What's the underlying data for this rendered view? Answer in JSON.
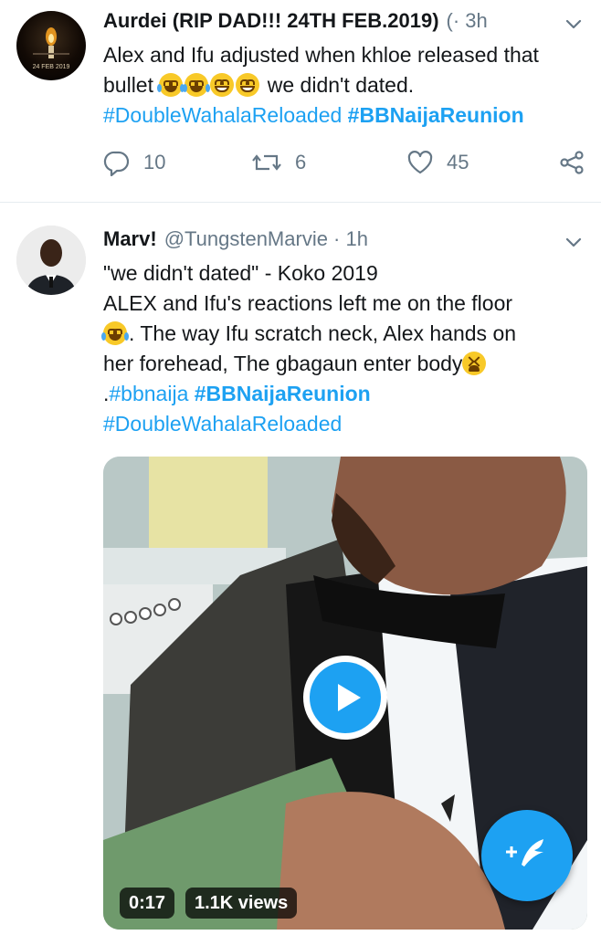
{
  "tweets": [
    {
      "name": "Aurdei (RIP DAD!!! 24TH FEB.2019)",
      "meta": "(· 3h",
      "avatar_text": "24 FEB 2019",
      "text_1": "Alex and Ifu adjusted when khloe released that bullet",
      "text_2": " we didn't dated.",
      "hashtag_1": "#DoubleWahalaReloaded",
      "hashtag_2": "#BBNaijaReunion",
      "emojis": [
        "joy",
        "joy",
        "grin",
        "grin"
      ],
      "reply_count": "10",
      "retweet_count": "6",
      "like_count": "45"
    },
    {
      "name": "Marv!",
      "meta": "@TungstenMarvie · 1h",
      "line_1": "\"we didn't dated\" - Koko 2019",
      "line_2": "ALEX and Ifu's reactions left me on the floor",
      "line_3": ". The way Ifu scratch neck, Alex hands on",
      "line_4": "her forehead, The gbagaun enter body",
      "line_5_prefix": ".",
      "hashtag_1": "#bbnaija",
      "hashtag_2": "#BBNaijaReunion",
      "hashtag_3": "#DoubleWahalaReloaded",
      "emojis": [
        "joy",
        "tired"
      ],
      "video": {
        "duration": "0:17",
        "views": "1.1K views"
      }
    }
  ],
  "icons": {
    "chevron": "chevron-down-icon",
    "reply": "reply-icon",
    "retweet": "retweet-icon",
    "like": "heart-icon",
    "share": "share-icon",
    "play": "play-icon",
    "compose": "compose-tweet-icon"
  },
  "colors": {
    "accent": "#1da1f2",
    "text": "#14171a",
    "secondary": "#657786",
    "divider": "#e6ecf0"
  }
}
